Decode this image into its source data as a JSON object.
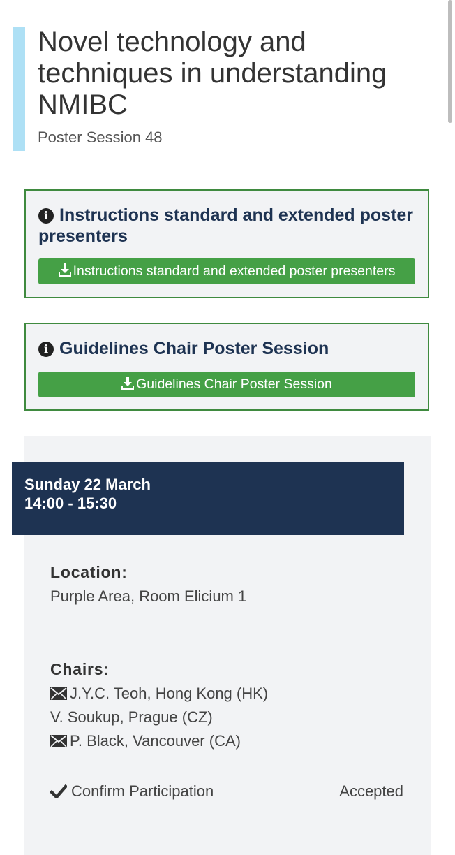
{
  "session": {
    "title": "Novel technology and techniques in understanding NMIBC",
    "subtitle": "Poster Session 48"
  },
  "boxes": [
    {
      "heading": "Instructions standard and extended poster presenters",
      "button_label": "Instructions standard and extended poster presenters"
    },
    {
      "heading": "Guidelines Chair Poster Session",
      "button_label": "Guidelines Chair Poster Session"
    }
  ],
  "schedule": {
    "day": "Sunday 22 March",
    "time": "14:00 - 15:30"
  },
  "location": {
    "label": "Location:",
    "value": "Purple Area, Room Elicium 1"
  },
  "chairs": {
    "label": "Chairs:",
    "items": [
      {
        "name": "J.Y.C. Teoh, Hong Kong (HK)",
        "icon": "envelope-icon"
      },
      {
        "name": "V. Soukup, Prague (CZ)",
        "icon": ""
      },
      {
        "name": "P. Black, Vancouver (CA)",
        "icon": "envelope-icon"
      }
    ]
  },
  "participation": {
    "label": "Confirm Participation",
    "status": "Accepted"
  },
  "colors": {
    "accent_bar": "#aee0f5",
    "box_border": "#3f8a3f",
    "button_green": "#45a046",
    "heading_navy": "#1e3352",
    "card_bg": "#f2f3f5"
  }
}
